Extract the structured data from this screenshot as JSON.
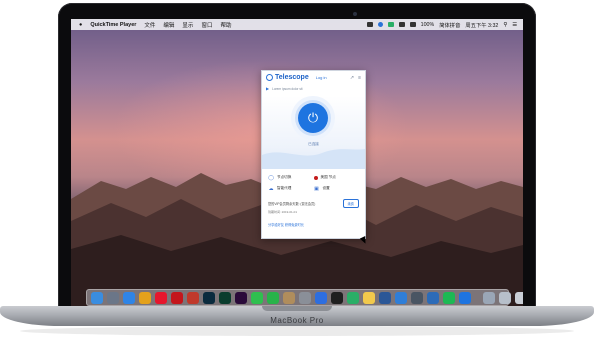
{
  "menubar": {
    "app_name": "QuickTime Player",
    "menus": [
      "文件",
      "编辑",
      "显示",
      "窗口",
      "帮助"
    ],
    "battery": "100%",
    "input_method": "简体拼音",
    "clock": "周五下午 3:32"
  },
  "telescope": {
    "brand": "Telescope",
    "login": "Log in",
    "notice": "Lorem ipsum dolor sit",
    "status": "已连接",
    "options": [
      {
        "label": "节点切换",
        "icon": "globe-icon"
      },
      {
        "label": "美国 节点",
        "icon": "flag-icon"
      },
      {
        "label": "智能代理",
        "icon": "cloud-icon"
      },
      {
        "label": "设置",
        "icon": "settings-icon"
      }
    ],
    "plan_text": "您的VIP会员剩余天数: (暂无会员)",
    "plan_button": "续费",
    "expire_text": "到期时间: 2019-01-01",
    "share_text": "分享给好友 获得免费时长"
  },
  "laptop": {
    "model": "MacBook Pro"
  },
  "dock": {
    "apps": [
      {
        "name": "Finder",
        "icon": "finder-icon",
        "color": "#3a8de0"
      },
      {
        "name": "Launchpad",
        "icon": "launchpad-icon",
        "color": "#6b7688"
      },
      {
        "name": "Safari",
        "icon": "safari-icon",
        "color": "#2f84e6"
      },
      {
        "name": "Chrome",
        "icon": "chrome-icon",
        "color": "#e4a11b"
      },
      {
        "name": "Weibo",
        "icon": "weibo-icon",
        "color": "#e6162d"
      },
      {
        "name": "NetEase Music",
        "icon": "music-icon",
        "color": "#c4161c"
      },
      {
        "name": "App Store",
        "icon": "appstore-icon",
        "color": "#c0392b"
      },
      {
        "name": "Photoshop",
        "icon": "photoshop-icon",
        "color": "#0b2b3e"
      },
      {
        "name": "Audition",
        "icon": "audition-icon",
        "color": "#0a3d2e"
      },
      {
        "name": "Premiere",
        "icon": "premiere-icon",
        "color": "#2a0a3a"
      },
      {
        "name": "Messages",
        "icon": "messages-icon",
        "color": "#2fbf4f"
      },
      {
        "name": "FaceTime",
        "icon": "facetime-icon",
        "color": "#28b34a"
      },
      {
        "name": "Contacts",
        "icon": "contacts-icon",
        "color": "#b08d5c"
      },
      {
        "name": "Preferences",
        "icon": "preferences-icon",
        "color": "#8a8f98"
      },
      {
        "name": "Quick",
        "icon": "q-icon",
        "color": "#2d6ee0"
      },
      {
        "name": "QQ",
        "icon": "qq-icon",
        "color": "#1f1f1f"
      },
      {
        "name": "WeChat",
        "icon": "wechat-icon",
        "color": "#2aae67"
      },
      {
        "name": "Notes",
        "icon": "notes-icon",
        "color": "#f2c94c"
      },
      {
        "name": "Word",
        "icon": "word-icon",
        "color": "#2b5797"
      },
      {
        "name": "Preview",
        "icon": "preview-icon",
        "color": "#2f7ed8"
      },
      {
        "name": "Time Machine",
        "icon": "clock-icon",
        "color": "#4a5563"
      },
      {
        "name": "Globe",
        "icon": "globe-icon",
        "color": "#2c6bb8"
      },
      {
        "name": "Spotify",
        "icon": "spotify-icon",
        "color": "#1db954"
      },
      {
        "name": "Telescope",
        "icon": "telescope-icon",
        "color": "#1e74e0"
      },
      {
        "name": "Downloads",
        "icon": "downloads-icon",
        "color": "#9aa6b6"
      },
      {
        "name": "Documents",
        "icon": "documents-icon",
        "color": "#b7bfca"
      },
      {
        "name": "Trash",
        "icon": "trash-icon",
        "color": "#c9ced6"
      }
    ]
  }
}
